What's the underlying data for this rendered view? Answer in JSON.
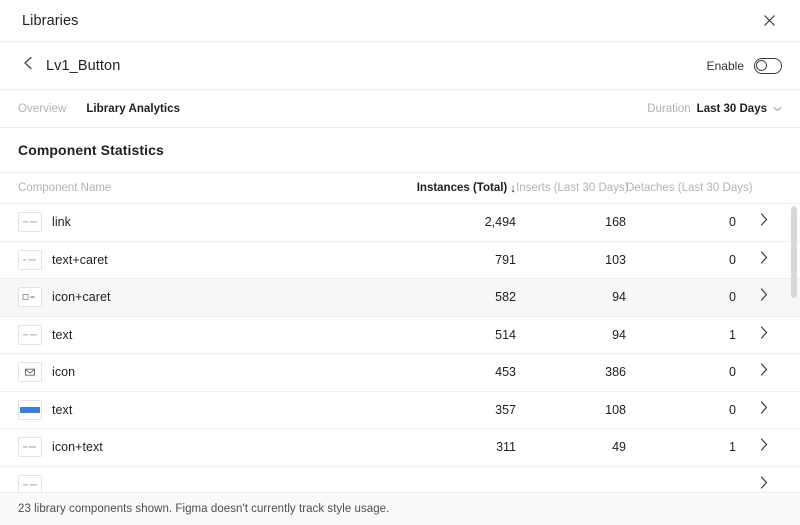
{
  "window": {
    "title": "Libraries",
    "close_icon": "close-icon"
  },
  "breadcrumb": {
    "back_icon": "chevron-left-icon",
    "library_name": "Lv1_Button",
    "enable_label": "Enable",
    "enable_state": "off"
  },
  "tabs": [
    {
      "label": "Overview",
      "active": false
    },
    {
      "label": "Library Analytics",
      "active": true
    }
  ],
  "duration": {
    "label": "Duration",
    "value": "Last 30 Days",
    "chevron_icon": "chevron-down-icon"
  },
  "section": {
    "title": "Component Statistics"
  },
  "table": {
    "columns": {
      "name": "Component Name",
      "instances": "Instances (Total)",
      "inserts": "Inserts (Last 30 Days)",
      "detaches": "Detaches (Last 30 Days)",
      "sort_arrow": "↓",
      "sorted_by": "instances"
    },
    "rows": [
      {
        "thumb": "text-line-thumb",
        "thumb_color": "#c9c9c9",
        "name": "link",
        "instances": "2,494",
        "inserts": "168",
        "detaches": "0",
        "highlight": false,
        "chevron_icon": "chevron-right-icon"
      },
      {
        "thumb": "text-caret-thumb",
        "thumb_color": "#c9c9c9",
        "name": "text+caret",
        "instances": "791",
        "inserts": "103",
        "detaches": "0",
        "highlight": false,
        "chevron_icon": "chevron-right-icon"
      },
      {
        "thumb": "icon-caret-thumb",
        "thumb_color": "#9e9e9e",
        "name": "icon+caret",
        "instances": "582",
        "inserts": "94",
        "detaches": "0",
        "highlight": true,
        "chevron_icon": "chevron-right-icon"
      },
      {
        "thumb": "text-line-thumb",
        "thumb_color": "#c9c9c9",
        "name": "text",
        "instances": "514",
        "inserts": "94",
        "detaches": "1",
        "highlight": false,
        "chevron_icon": "chevron-right-icon"
      },
      {
        "thumb": "mail-icon-thumb",
        "thumb_color": "#6e6e6e",
        "name": "icon",
        "instances": "453",
        "inserts": "386",
        "detaches": "0",
        "highlight": false,
        "chevron_icon": "chevron-right-icon"
      },
      {
        "thumb": "blue-bar-thumb",
        "thumb_color": "#3b7ddd",
        "name": "text",
        "instances": "357",
        "inserts": "108",
        "detaches": "0",
        "highlight": false,
        "chevron_icon": "chevron-right-icon"
      },
      {
        "thumb": "icon-text-thumb",
        "thumb_color": "#c9c9c9",
        "name": "icon+text",
        "instances": "311",
        "inserts": "49",
        "detaches": "1",
        "highlight": false,
        "chevron_icon": "chevron-right-icon"
      },
      {
        "thumb": "text-line-thumb",
        "thumb_color": "#c9c9c9",
        "name": "",
        "instances": "",
        "inserts": "",
        "detaches": "",
        "highlight": false,
        "chevron_icon": "chevron-right-icon"
      }
    ]
  },
  "footer": {
    "text": "23 library components shown. Figma doesn't currently track style usage."
  },
  "colors": {
    "accent_blue": "#3b7ddd",
    "text_primary": "#1f1f1f",
    "text_muted": "#b3b3b3",
    "divider": "#ececec",
    "row_highlight": "#f7f7f7",
    "footer_bg": "#fafafa"
  }
}
